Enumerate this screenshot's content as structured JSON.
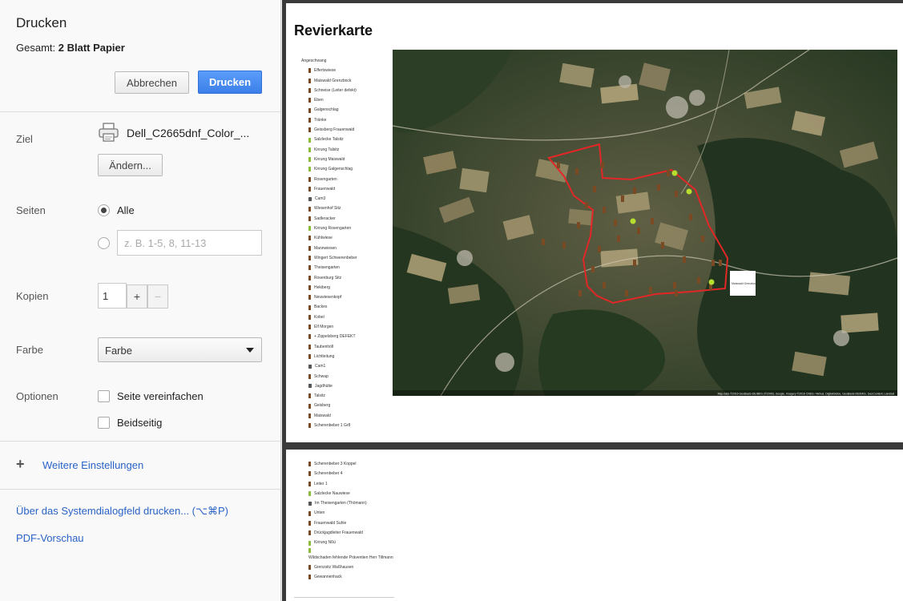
{
  "dialog": {
    "title": "Drucken",
    "total_label": "Gesamt:",
    "total_value": "2 Blatt Papier",
    "cancel_label": "Abbrechen",
    "print_label": "Drucken"
  },
  "settings": {
    "destination": {
      "label": "Ziel",
      "printer": "Dell_C2665dnf_Color_...",
      "change_label": "Ändern..."
    },
    "pages": {
      "label": "Seiten",
      "all_label": "Alle",
      "all_selected": true,
      "range_placeholder": "z. B. 1-5, 8, 11-13"
    },
    "copies": {
      "label": "Kopien",
      "value": "1",
      "plus": "+",
      "minus": "−"
    },
    "color": {
      "label": "Farbe",
      "value": "Farbe"
    },
    "options": {
      "label": "Optionen",
      "simplify_label": "Seite vereinfachen",
      "duplex_label": "Beidseitig",
      "simplify_checked": false,
      "duplex_checked": false
    },
    "more_label": "Weitere Einstellungen",
    "system_dialog_label": "Über das Systemdialogfeld drucken... (⌥⌘P)",
    "pdf_preview_label": "PDF-Vorschau"
  },
  "preview": {
    "page1": {
      "title": "Revierkarte",
      "legend_heading": "Angeschwang",
      "legend_items": [
        {
          "label": "Effertswiese",
          "icon": "stand"
        },
        {
          "label": "Maiswald Grenzbock",
          "icon": "stand"
        },
        {
          "label": "Schneise (Leiter defekt)",
          "icon": "stand"
        },
        {
          "label": "Eben",
          "icon": "stand"
        },
        {
          "label": "Galgenschlag",
          "icon": "stand"
        },
        {
          "label": "Tränke",
          "icon": "stand"
        },
        {
          "label": "Geissberg Frauenwald",
          "icon": "stand"
        },
        {
          "label": "Salzlecke Talsitz",
          "icon": "salt"
        },
        {
          "label": "Kirrung Talsitz",
          "icon": "feeding"
        },
        {
          "label": "Kirrung Maiswald",
          "icon": "feeding"
        },
        {
          "label": "Kirrung Galgenschlag",
          "icon": "feeding"
        },
        {
          "label": "Rosengarten",
          "icon": "stand"
        },
        {
          "label": "Frauenwald",
          "icon": "stand"
        },
        {
          "label": "Cam3",
          "icon": "camera"
        },
        {
          "label": "Wiesenhof Sitz",
          "icon": "stand"
        },
        {
          "label": "Sadleracker",
          "icon": "stand"
        },
        {
          "label": "Kirrung Rosengarten",
          "icon": "feeding"
        },
        {
          "label": "Kühlwiese",
          "icon": "stand"
        },
        {
          "label": "Mannwiesen",
          "icon": "stand"
        },
        {
          "label": "Wingert Schwerenbeber",
          "icon": "stand"
        },
        {
          "label": "Theisengarten",
          "icon": "stand"
        },
        {
          "label": "Rosenburg Sitz",
          "icon": "stand"
        },
        {
          "label": "Hekiberg",
          "icon": "stand"
        },
        {
          "label": "Neuwiesenkopf",
          "icon": "stand"
        },
        {
          "label": "Backes",
          "icon": "stand"
        },
        {
          "label": "Kobel",
          "icon": "stand"
        },
        {
          "label": "Elf Morgen",
          "icon": "stand"
        },
        {
          "label": "+ Zippelsberg DEFEKT",
          "icon": "stand"
        },
        {
          "label": "Taubenhöll",
          "icon": "stand"
        },
        {
          "label": "Lichtleitung",
          "icon": "stand"
        },
        {
          "label": "Cam1",
          "icon": "camera"
        },
        {
          "label": "Schwap",
          "icon": "stand"
        },
        {
          "label": "Jagdhütte",
          "icon": "hut"
        },
        {
          "label": "Talsitz",
          "icon": "stand"
        },
        {
          "label": "Geisberg",
          "icon": "stand"
        },
        {
          "label": "Maiswald",
          "icon": "stand"
        },
        {
          "label": "Scherenbeber 1 Gr8",
          "icon": "stand"
        }
      ],
      "map_attribution": "Map data ©2016 GeoBasis-DE/BKG (©2009), Google, Imagery ©2016 CNES / Airbus, DigitalGlobe, GeoBasis-DE/BKG, GeoContent, Landsat"
    },
    "page2": {
      "legend_items": [
        {
          "label": "Scherenbeber 3 Koppel",
          "icon": "stand"
        },
        {
          "label": "Scherenbeber 4",
          "icon": "stand"
        },
        {
          "label": "Leiter 1",
          "icon": "stand"
        },
        {
          "label": "Salzlecke Nauwiese",
          "icon": "salt"
        },
        {
          "label": "Im Theisengarten (Thömann)",
          "icon": "hut"
        },
        {
          "label": "Unten",
          "icon": "stand"
        },
        {
          "label": "Frauenwald Suhle",
          "icon": "stand"
        },
        {
          "label": "Drückjagdleiter Frauenwald",
          "icon": "stand"
        },
        {
          "label": "Kirrung Nßü",
          "icon": "feeding"
        },
        {
          "label": "",
          "icon": "feeding"
        },
        {
          "label": "Wildschaden fehlende Präventien Herr Tillmann",
          "icon": "none"
        },
        {
          "label": "Grenzsitz Waßhausen",
          "icon": "stand"
        },
        {
          "label": "Gewannenhack",
          "icon": "stand"
        }
      ]
    }
  },
  "colors": {
    "accent": "#3c7fe8",
    "link": "#2a63c7",
    "boundary": "#e32626",
    "stand_marker": "#7a4a25",
    "feeding_marker": "#b7dd2e"
  }
}
